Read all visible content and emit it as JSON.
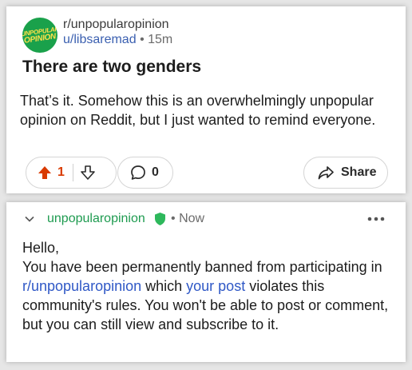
{
  "post": {
    "subreddit": "r/unpopularopinion",
    "avatar_text_top": "UNPOPULAR",
    "avatar_text_bottom": "OPINION",
    "author": "u/libsaremad",
    "separator": "•",
    "age": "15m",
    "title": "There are two genders",
    "body": "That’s it. Somehow this is an overwhelmingly unpopular opinion on Reddit, but I just wanted to remind everyone.",
    "vote_count": "1",
    "comment_count": "0",
    "share_label": "Share",
    "colors": {
      "upvote": "#d93a00",
      "avatar_bg": "#1aa14b",
      "avatar_text": "#ffe14a"
    }
  },
  "mod_message": {
    "author": "unpopularopinion",
    "separator": "•",
    "time": "Now",
    "greeting": "Hello,",
    "line_start": "You have been permanently banned from participating in ",
    "subreddit_link": "r/unpopularopinion",
    "line_mid": " which ",
    "post_link_text": "your post",
    "line_end": " violates this community's rules. You won't be able to post or comment, but you can still view and subscribe to it.",
    "colors": {
      "name": "#1e9b50",
      "shield": "#2eb85c",
      "link": "#2f58c6"
    }
  },
  "icons": {
    "upvote": "upvote-arrow-icon",
    "downvote": "downvote-arrow-icon",
    "comment": "comment-bubble-icon",
    "share": "share-arrow-icon",
    "collapse": "chevron-down-icon",
    "shield": "shield-icon",
    "more": "more-dots-icon"
  }
}
